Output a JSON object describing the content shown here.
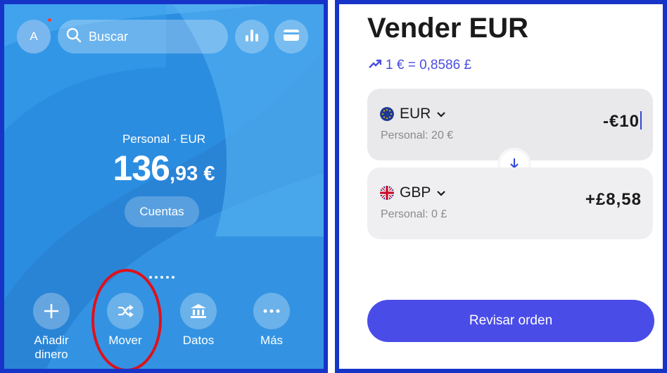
{
  "left": {
    "avatar_initial": "A",
    "search_placeholder": "Buscar",
    "account_label": "Personal · EUR",
    "balance": {
      "integer": "136",
      "decimal": ",93",
      "currency": " €"
    },
    "accounts_button": "Cuentas",
    "actions": [
      {
        "label_line1": "Añadir",
        "label_line2": "dinero",
        "icon": "plus-icon"
      },
      {
        "label_line1": "Mover",
        "label_line2": "",
        "icon": "shuffle-icon"
      },
      {
        "label_line1": "Datos",
        "label_line2": "",
        "icon": "bank-icon"
      },
      {
        "label_line1": "Más",
        "label_line2": "",
        "icon": "more-icon"
      }
    ],
    "top_icons": [
      "bar-chart-icon",
      "card-icon"
    ],
    "highlighted_action": "Mover",
    "highlight_color": "#e0101a"
  },
  "right": {
    "title": "Vender EUR",
    "rate": "1 € = 0,8586 £",
    "from": {
      "currency": "EUR",
      "balance": "Personal:     20 €",
      "amount": "-€10"
    },
    "to": {
      "currency": "GBP",
      "balance": "Personal: 0 £",
      "amount": "+£8,58"
    },
    "review_button": "Revisar orden",
    "accent_color": "#4a4ce8"
  }
}
